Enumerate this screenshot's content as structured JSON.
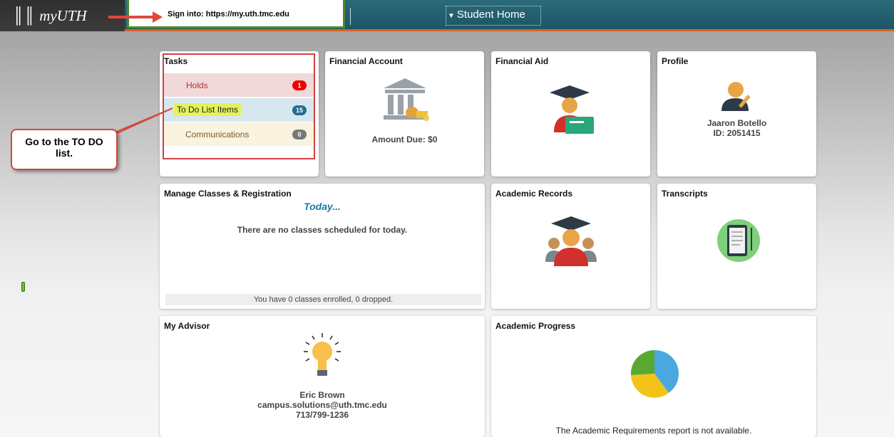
{
  "header": {
    "logo_text": "myUTH",
    "signin_text": "Sign into:  https://my.uth.tmc.edu",
    "nav_title": "Student Home"
  },
  "annotation": {
    "callout_text": "Go to the TO DO list."
  },
  "tiles": {
    "tasks": {
      "title": "Tasks",
      "items": [
        {
          "label": "Holds",
          "count": "1"
        },
        {
          "label": "To Do List Items",
          "count": "15"
        },
        {
          "label": "Communications",
          "count": "0"
        }
      ]
    },
    "financial_account": {
      "title": "Financial Account",
      "amount_due": "Amount Due: $0"
    },
    "financial_aid": {
      "title": "Financial Aid"
    },
    "profile": {
      "title": "Profile",
      "name": "Jaaron Botello",
      "id": "ID: 2051415"
    },
    "manage_classes": {
      "title": "Manage Classes & Registration",
      "today": "Today...",
      "message": "There are no classes scheduled for today.",
      "enrollment": "You have 0 classes enrolled,  0 dropped."
    },
    "academic_records": {
      "title": "Academic Records"
    },
    "transcripts": {
      "title": "Transcripts"
    },
    "my_advisor": {
      "title": "My Advisor",
      "name": "Eric Brown",
      "email": "campus.solutions@uth.tmc.edu",
      "phone": "713/799-1236"
    },
    "academic_progress": {
      "title": "Academic Progress",
      "message": "The Academic Requirements report is not available."
    }
  },
  "colors": {
    "header_bg": "#1d5666",
    "accent_orange": "#d9642a",
    "holds_badge": "#ee0000",
    "todo_badge": "#1f6f8f",
    "highlight": "#e5f25a"
  }
}
